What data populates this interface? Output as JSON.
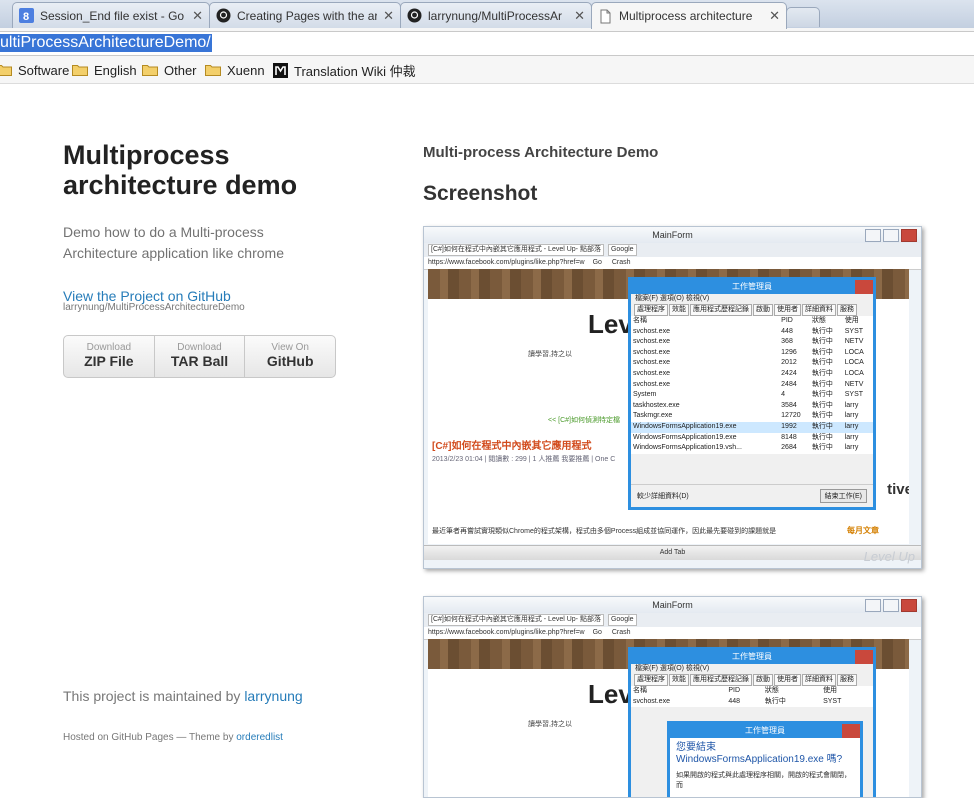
{
  "browser": {
    "tabs": [
      {
        "title": "Session_End file exist - Go",
        "icon": "google-g-icon",
        "active": false
      },
      {
        "title": "Creating Pages with the ar",
        "icon": "github-icon",
        "active": false
      },
      {
        "title": "larrynung/MultiProcessAr",
        "icon": "github-icon",
        "active": false
      },
      {
        "title": "Multiprocess architecture",
        "icon": "page-icon",
        "active": true
      }
    ],
    "close_glyph": "✕",
    "url": "ultiProcessArchitectureDemo/",
    "bookmarks": [
      {
        "label": "Software",
        "icon": "folder-icon"
      },
      {
        "label": "English",
        "icon": "folder-icon"
      },
      {
        "label": "Other",
        "icon": "folder-icon"
      },
      {
        "label": "Xuenn",
        "icon": "folder-icon"
      },
      {
        "label": "Translation Wiki 仲裁",
        "icon": "m-logo-icon"
      }
    ]
  },
  "sidebar": {
    "title_line1": "Multiprocess",
    "title_line2": "architecture demo",
    "desc_line1": "Demo how to do a Multi-process",
    "desc_line2": "Architecture application like chrome",
    "github_link": "View the Project on GitHub",
    "github_repo": "larrynung/MultiProcessArchitectureDemo",
    "downloads": [
      {
        "small": "Download",
        "big": "ZIP File"
      },
      {
        "small": "Download",
        "big": "TAR Ball"
      },
      {
        "small": "View On",
        "big": "GitHub"
      }
    ],
    "maintained_prefix": "This project is maintained by ",
    "maintainer": "larrynung",
    "hosted_prefix": "Hosted on GitHub Pages — Theme by ",
    "theme_author": "orderedlist"
  },
  "main": {
    "heading": "Multi-process Architecture Demo",
    "section_title": "Screenshot"
  },
  "screenshot": {
    "window_title": "MainForm",
    "tab_label": "[C#]如何在程式中內嵌其它應用程式 - Level Up- 點部落",
    "tab2": "Google",
    "address": "https://www.facebook.com/plugins/like.php?href=w",
    "go": "Go",
    "crash": "Crash",
    "big_text": "Lev",
    "subtitle": "讀學習,持之以",
    "green_link": "<< [C#]如何偵測特定檔",
    "post_title": "[C#]如何在程式中內嵌其它應用程式",
    "post_meta": "2013/2/23 01:04 | 閱讀數 : 299 | 1 人推薦 我要推薦 | One C",
    "body_text": "最近筆者再嘗試實現類似Chrome的程式架構，程式由多個Process組成並協同運作，因此最先要碰到的課題就是",
    "orange_text": "每月文章",
    "ive_text": "tive",
    "add_tab": "Add Tab",
    "watermark": "Level Up"
  },
  "taskmgr": {
    "title": "工作管理員",
    "menu": "檔案(F)   選項(O)   檢視(V)",
    "tabs": [
      "處理程序",
      "效能",
      "應用程式歷程記錄",
      "啟動",
      "使用者",
      "詳細資料",
      "服務"
    ],
    "headers": [
      "名稱",
      "PID",
      "狀態",
      "使用"
    ],
    "rows": [
      [
        "svchost.exe",
        "448",
        "執行中",
        "SYST"
      ],
      [
        "svchost.exe",
        "368",
        "執行中",
        "NETV"
      ],
      [
        "svchost.exe",
        "1296",
        "執行中",
        "LOCA"
      ],
      [
        "svchost.exe",
        "2012",
        "執行中",
        "LOCA"
      ],
      [
        "svchost.exe",
        "2424",
        "執行中",
        "LOCA"
      ],
      [
        "svchost.exe",
        "2484",
        "執行中",
        "NETV"
      ],
      [
        "System",
        "4",
        "執行中",
        "SYST"
      ],
      [
        "taskhostex.exe",
        "3584",
        "執行中",
        "larry"
      ],
      [
        "Taskmgr.exe",
        "12720",
        "執行中",
        "larry"
      ],
      [
        "WindowsFormsApplication19.exe",
        "1992",
        "執行中",
        "larry"
      ],
      [
        "WindowsFormsApplication19.exe",
        "8148",
        "執行中",
        "larry"
      ],
      [
        "WindowsFormsApplication19.vsh...",
        "2684",
        "執行中",
        "larry"
      ]
    ],
    "less": "較少詳細資料(D)",
    "end_task": "結束工作(E)"
  },
  "dialog": {
    "title": "工作管理員",
    "question": "您要結束 WindowsFormsApplication19.exe 嗎?",
    "small": "如果開啟的程式與此處理程序相關，開啟的程式會關閉，而"
  }
}
